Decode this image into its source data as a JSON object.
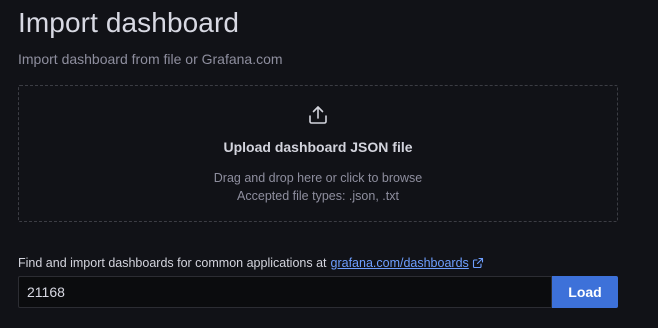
{
  "page": {
    "title": "Import dashboard",
    "subtitle": "Import dashboard from file or Grafana.com"
  },
  "upload": {
    "icon": "upload-icon",
    "title": "Upload dashboard JSON file",
    "hint": "Drag and drop here or click to browse",
    "accepted_types": "Accepted file types: .json, .txt"
  },
  "grafana_com": {
    "find_text": "Find and import dashboards for common applications at",
    "link_text": "grafana.com/dashboards",
    "link_icon": "external-link-icon",
    "input_value": "21168",
    "load_label": "Load"
  },
  "colors": {
    "background": "#111217",
    "primary_button": "#3d71d9",
    "link": "#6e9fff"
  }
}
